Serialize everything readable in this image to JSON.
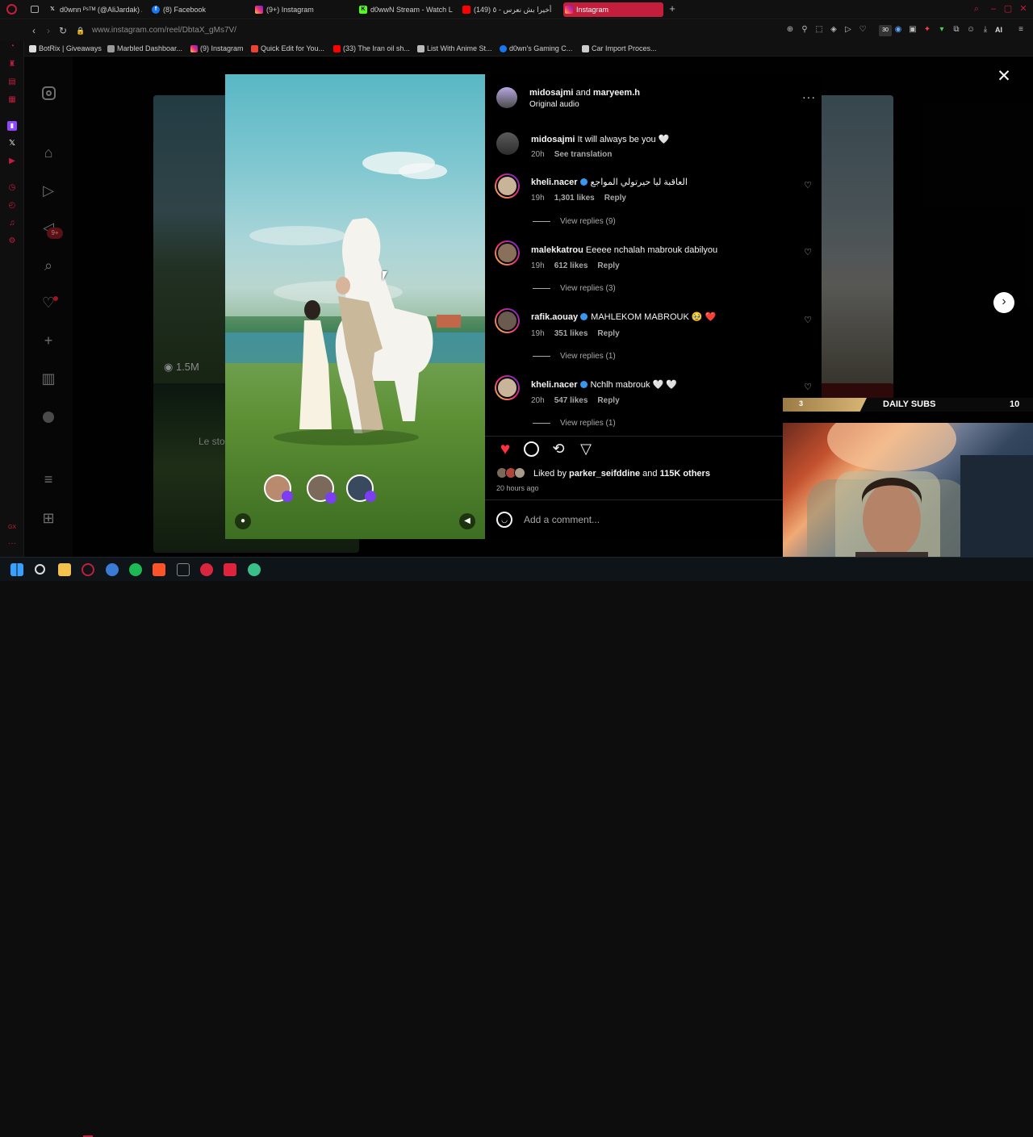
{
  "browser": {
    "tabs": [
      {
        "label": "d0wnn ᴾˢᵀᴹ (@AliJardak) /",
        "icon": "x-icon"
      },
      {
        "label": "(8) Facebook",
        "icon": "facebook-icon"
      },
      {
        "label": "(9+) Instagram",
        "icon": "instagram-icon"
      },
      {
        "label": "d0wwN Stream - Watch Li...",
        "icon": "kick-icon"
      },
      {
        "label": "(149) أخيرا بش نعرس - ٥",
        "icon": "youtube-icon"
      },
      {
        "label": "Instagram",
        "icon": "instagram-icon"
      }
    ],
    "url": "www.instagram.com/reel/DbtaX_gMs7V/",
    "bookmarks": [
      {
        "label": "BotRix | Giveaways"
      },
      {
        "label": "Marbled Dashboar..."
      },
      {
        "label": "(9) Instagram"
      },
      {
        "label": "Quick Edit for You..."
      },
      {
        "label": "(33) The Iran oil sh..."
      },
      {
        "label": "List With Anime St..."
      },
      {
        "label": "d0wn's Gaming C..."
      },
      {
        "label": "Car Import Proces..."
      }
    ],
    "ai_label": "AI",
    "badge": "30"
  },
  "instagram": {
    "views": "1.5M",
    "bg_caption": "Le sto",
    "notification_badge": "9+",
    "post": {
      "author1": "midosajmi",
      "joiner": "and",
      "author2": "maryeem.h",
      "audio": "Original audio",
      "caption_user": "midosajmi",
      "caption_text": "It will always be you 🤍",
      "caption_time": "20h",
      "see_translation": "See translation",
      "comments": [
        {
          "user": "kheli.nacer",
          "verified": true,
          "text": "العاقبة ليا حيرتولي المواجع",
          "time": "19h",
          "likes": "1,301 likes",
          "reply": "Reply",
          "view_replies": "View replies (9)"
        },
        {
          "user": "malekkatrou",
          "verified": false,
          "text": "Eeeee nchalah mabrouk dabilyou",
          "time": "19h",
          "likes": "612 likes",
          "reply": "Reply",
          "view_replies": "View replies (3)"
        },
        {
          "user": "rafik.aouay",
          "verified": true,
          "text": "MAHLEKOM MABROUK 🥹 ❤️",
          "time": "19h",
          "likes": "351 likes",
          "reply": "Reply",
          "view_replies": "View replies (1)"
        },
        {
          "user": "kheli.nacer",
          "verified": true,
          "text": "Nchlh mabrouk 🤍 🤍",
          "time": "20h",
          "likes": "547 likes",
          "reply": "Reply",
          "view_replies": "View replies (1)"
        }
      ],
      "liked_by_prefix": "Liked by",
      "liked_by_user": "parker_seifddine",
      "liked_by_and": "and",
      "liked_by_others": "115K others",
      "posted_ago": "20 hours ago",
      "comment_placeholder": "Add a comment..."
    }
  },
  "stream_overlay": {
    "subs_left": "3",
    "subs_label": "DAILY SUBS",
    "subs_right": "10"
  },
  "colors": {
    "opera_red": "#c31e3b",
    "like_red": "#ff3040",
    "verified_blue": "#3897f0"
  }
}
